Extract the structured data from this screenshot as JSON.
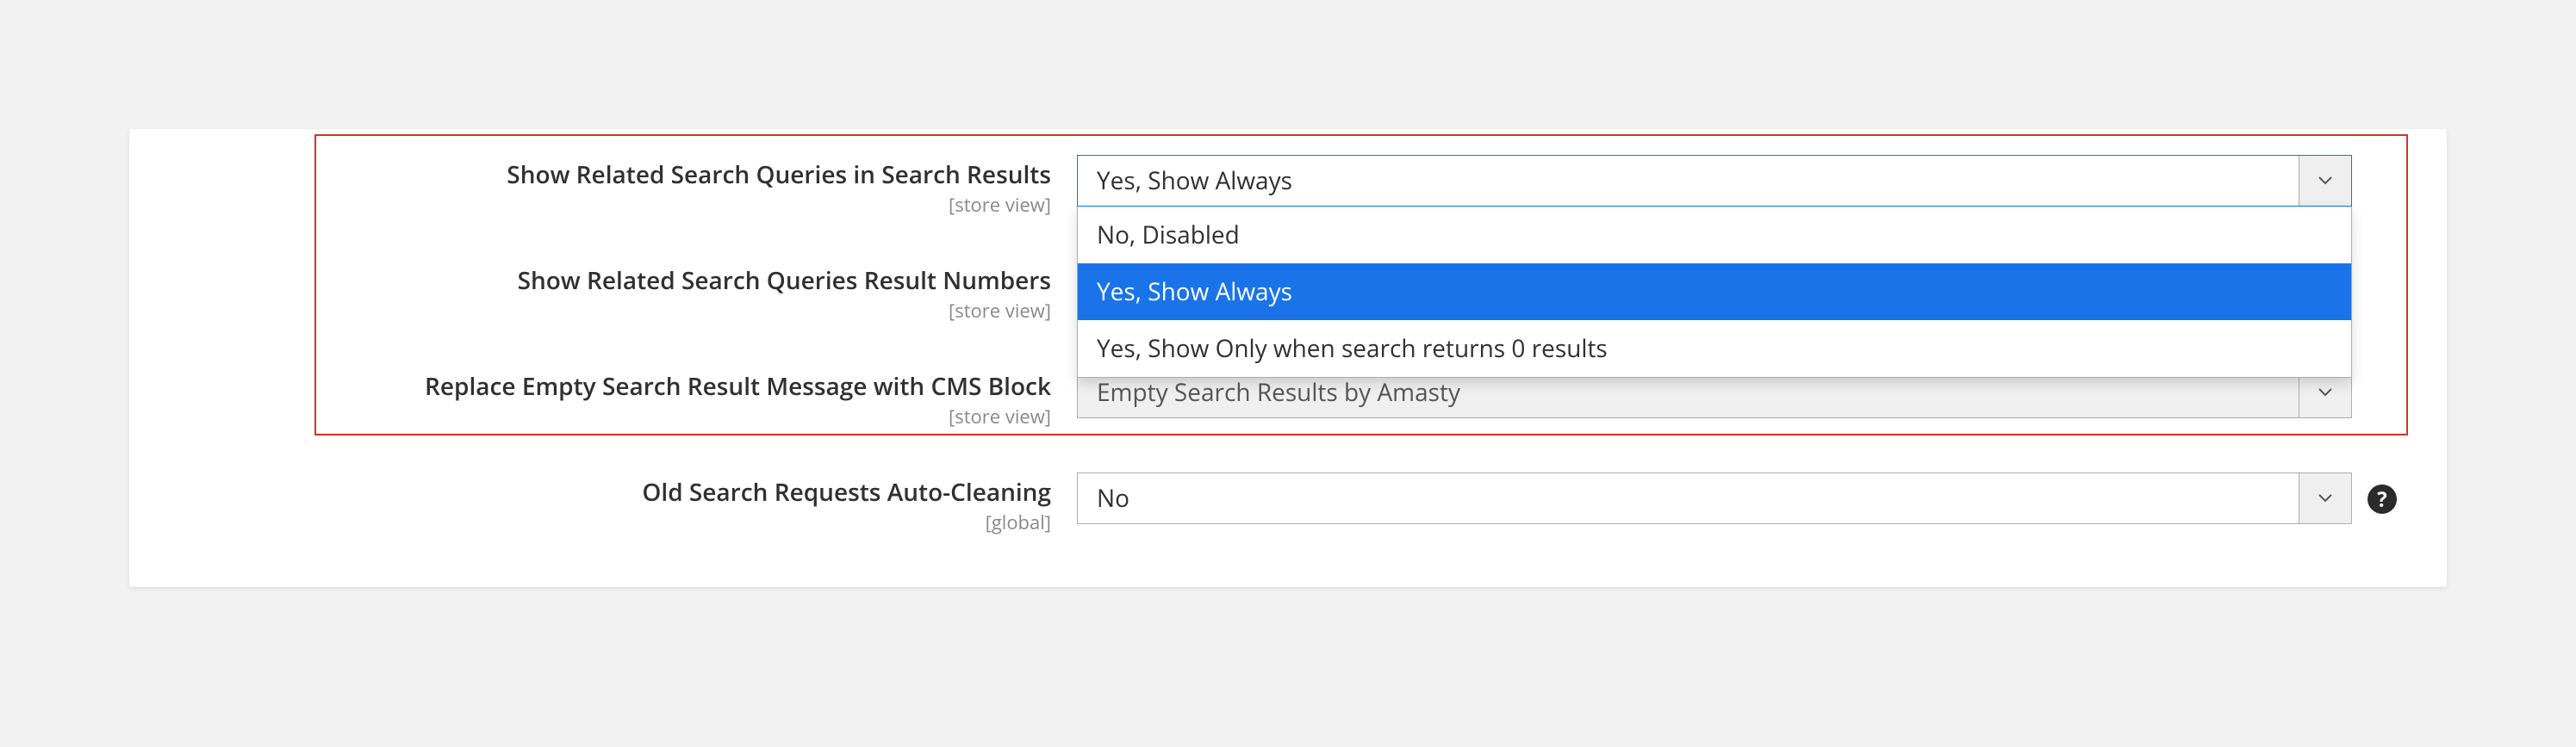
{
  "fields": {
    "related_queries": {
      "label": "Show Related Search Queries in Search Results",
      "scope": "[store view]",
      "value": "Yes, Show Always",
      "options": [
        "No, Disabled",
        "Yes, Show Always",
        "Yes, Show Only when search returns 0 results"
      ]
    },
    "result_numbers": {
      "label": "Show Related Search Queries Result Numbers",
      "scope": "[store view]"
    },
    "empty_block": {
      "label": "Replace Empty Search Result Message with CMS Block",
      "scope": "[store view]",
      "value": "Empty Search Results by Amasty"
    },
    "auto_clean": {
      "label": "Old Search Requests Auto-Cleaning",
      "scope": "[global]",
      "value": "No"
    }
  },
  "help_glyph": "?"
}
